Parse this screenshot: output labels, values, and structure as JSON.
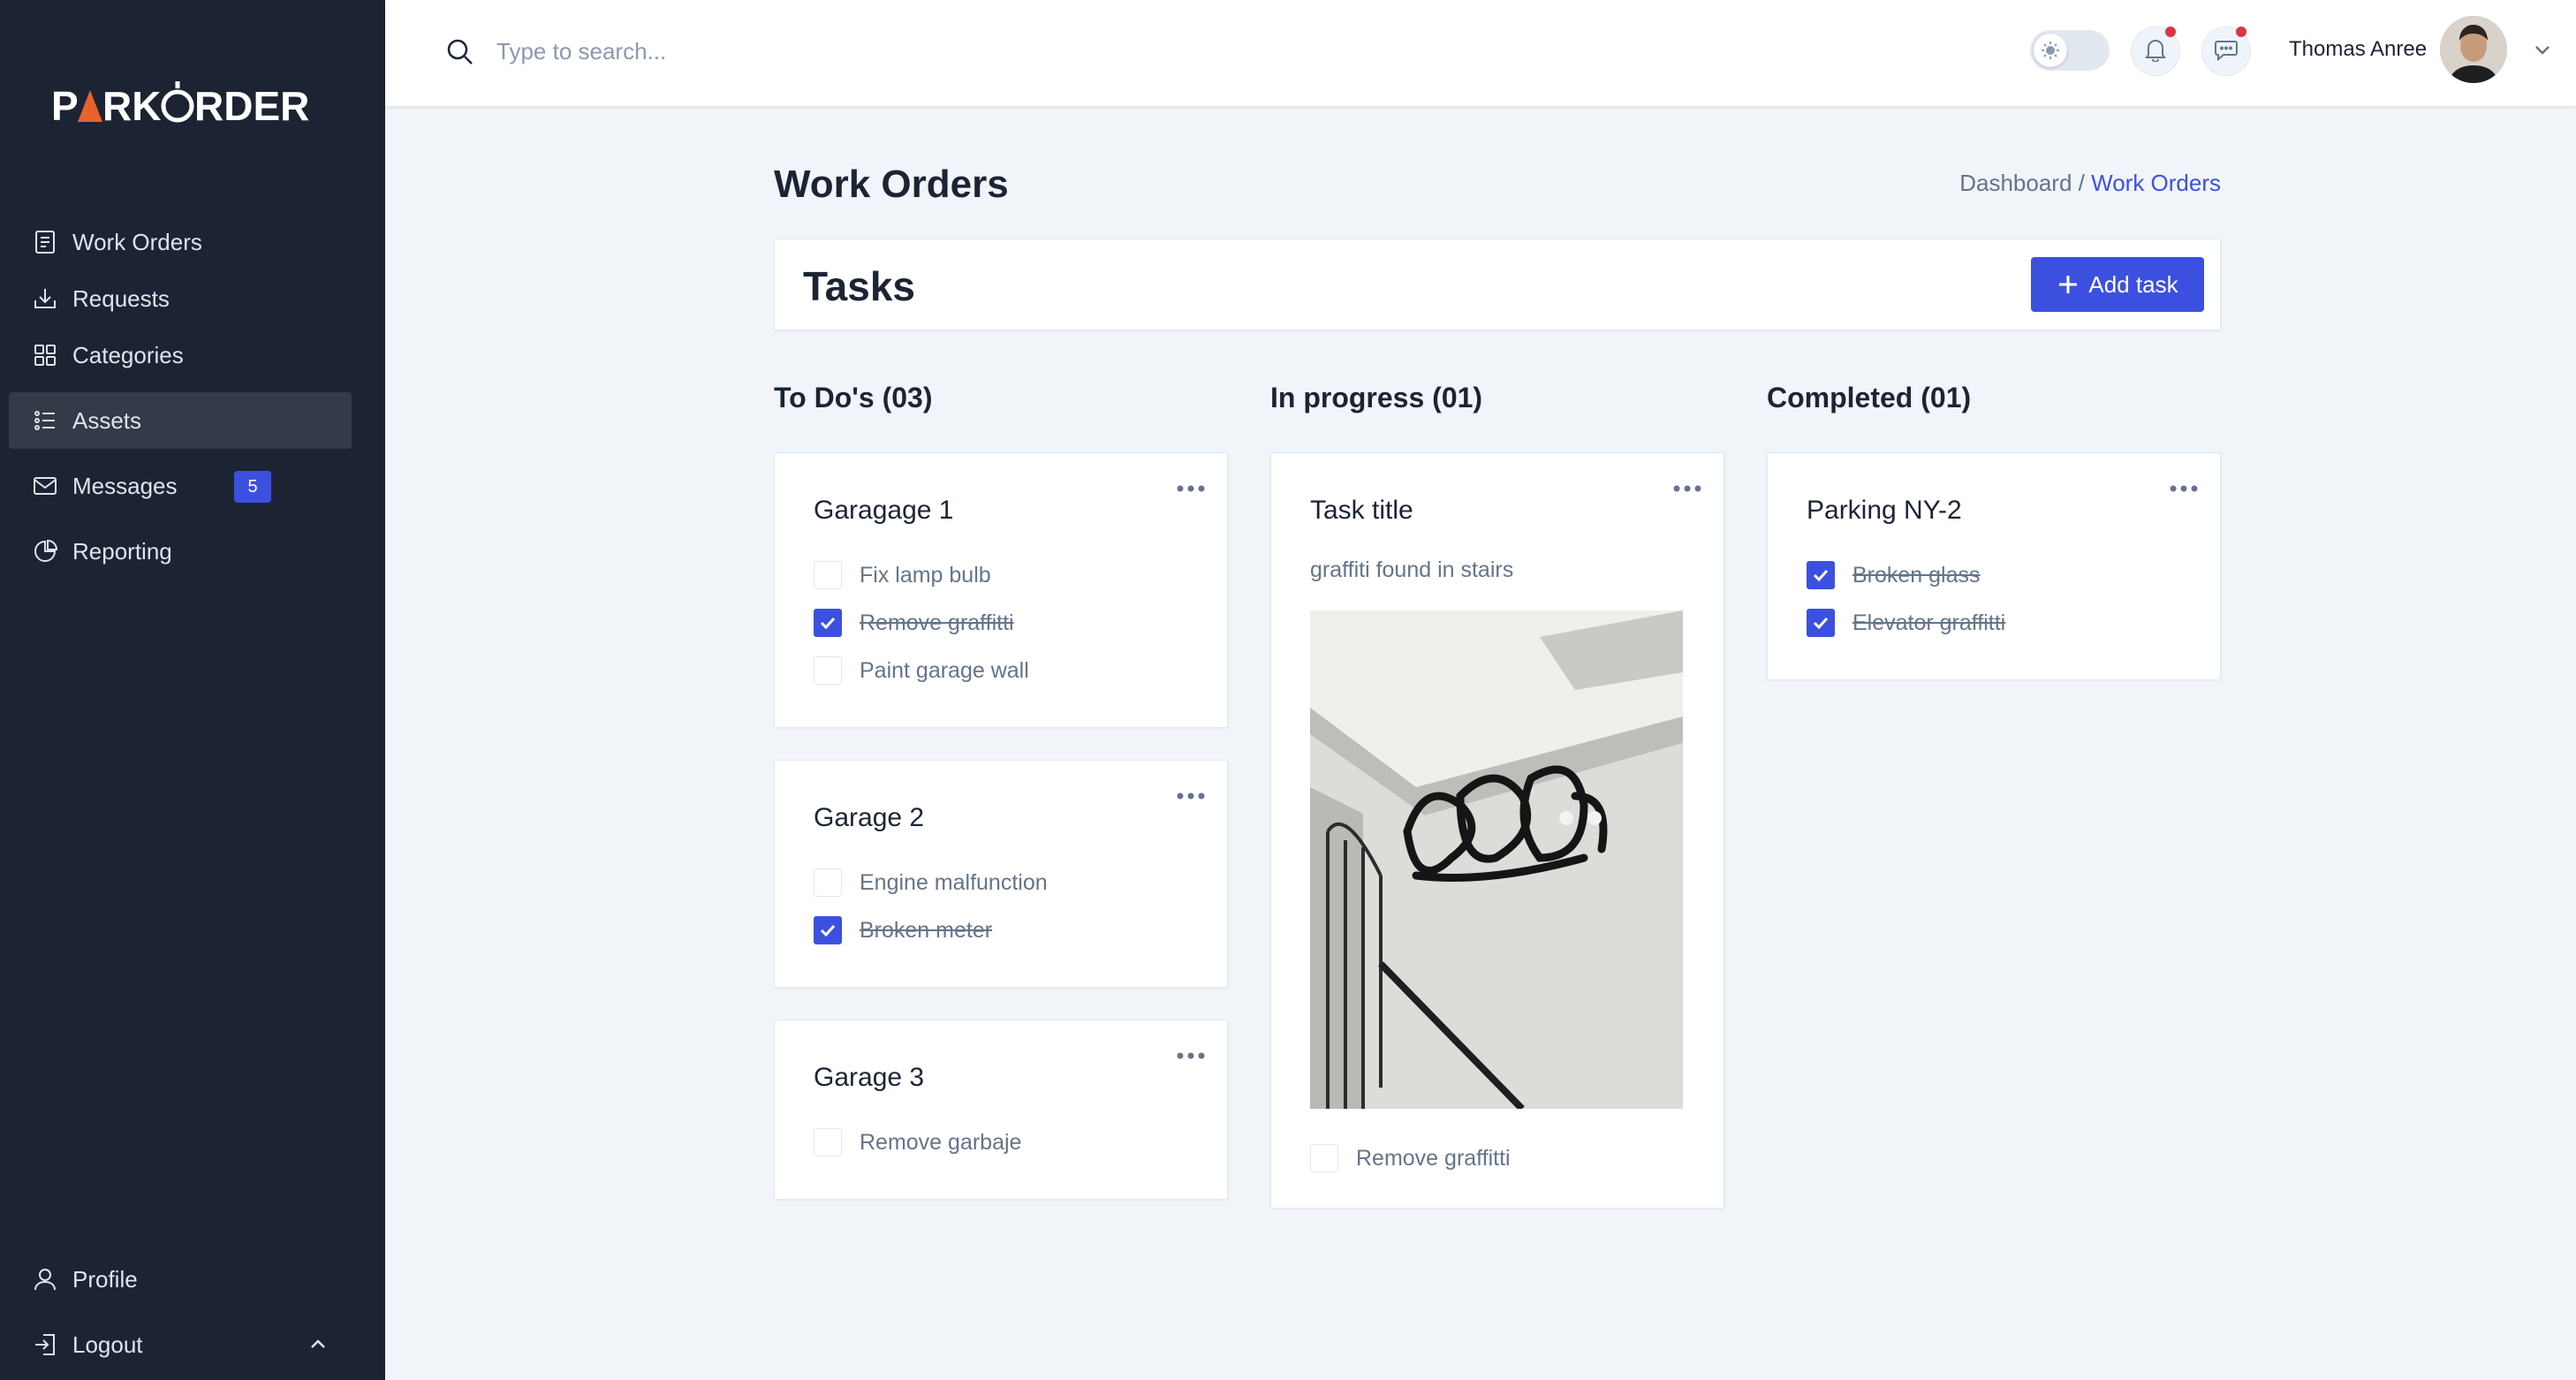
{
  "brand": {
    "logo_text": "PARKORDER",
    "accent": "#3c50e0",
    "sidebar_bg": "#1c2434",
    "alert": "#dc3545"
  },
  "sidebar": {
    "items": [
      {
        "label": "Work Orders",
        "icon": "document-icon"
      },
      {
        "label": "Requests",
        "icon": "inbox-download-icon"
      },
      {
        "label": "Categories",
        "icon": "grid-icon"
      },
      {
        "label": "Assets",
        "icon": "list-icon",
        "active": true
      },
      {
        "label": "Messages",
        "icon": "mail-icon",
        "badge": "5"
      },
      {
        "label": "Reporting",
        "icon": "pie-chart-icon"
      }
    ],
    "bottom": [
      {
        "label": "Profile",
        "icon": "user-icon"
      },
      {
        "label": "Logout",
        "icon": "logout-icon"
      }
    ]
  },
  "header": {
    "search_placeholder": "Type to search...",
    "user_name": "Thomas Anree"
  },
  "main": {
    "page_title": "Work Orders",
    "breadcrumb": {
      "parent": "Dashboard /",
      "current": "Work Orders"
    },
    "tasks_title": "Tasks",
    "add_task_label": "Add task",
    "columns": [
      {
        "title": "To Do's (03)",
        "cards": [
          {
            "title": "Garagage 1",
            "items": [
              {
                "label": "Fix lamp bulb",
                "checked": false
              },
              {
                "label": "Remove graffitti",
                "checked": true
              },
              {
                "label": "Paint garage wall",
                "checked": false
              }
            ]
          },
          {
            "title": "Garage 2",
            "items": [
              {
                "label": "Engine malfunction",
                "checked": false
              },
              {
                "label": "Broken meter",
                "checked": true
              }
            ]
          },
          {
            "title": "Garage 3",
            "items": [
              {
                "label": "Remove garbaje",
                "checked": false
              }
            ]
          }
        ]
      },
      {
        "title": "In progress (01)",
        "cards": [
          {
            "title": "Task title",
            "description": "graffiti found in stairs",
            "image": "stairwell-graffiti-photo",
            "items": [
              {
                "label": "Remove graffitti",
                "checked": false
              }
            ]
          }
        ]
      },
      {
        "title": "Completed (01)",
        "cards": [
          {
            "title": "Parking NY-2",
            "items": [
              {
                "label": "Broken glass",
                "checked": true
              },
              {
                "label": "Elevator graffitti",
                "checked": true
              }
            ]
          }
        ]
      }
    ]
  }
}
